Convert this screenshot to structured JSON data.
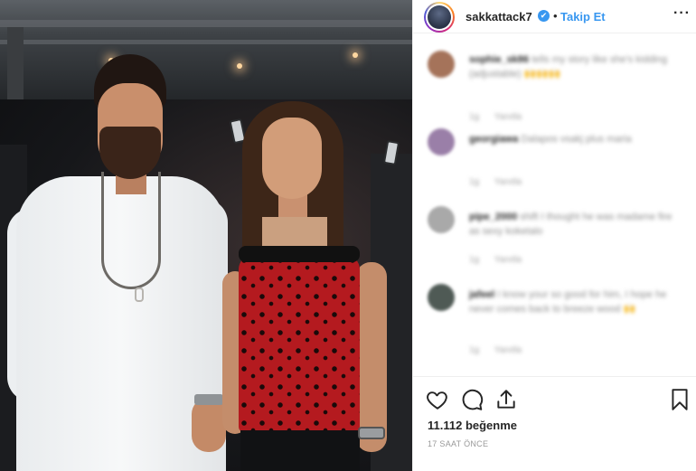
{
  "post": {
    "username": "sakkattack7",
    "verified_mark": "✔",
    "separator": "•",
    "follow_label": "Takip Et",
    "more_icon": "more-options-icon",
    "likes_text": "11.112 beğenme",
    "timestamp": "17 SAAT ÖNCE"
  },
  "comments": [
    {
      "author": "sophie_sk86",
      "text": "tells my story like she's kidding (adjustable) 🙌🙌🙌",
      "meta": "1g Yanıtla",
      "avatar_color": "#a5735a"
    },
    {
      "author": "georgiawa",
      "text": "Dalapos vsakj plus maria",
      "meta": "1g Yanıtla",
      "avatar_color": "#9a7fa8"
    },
    {
      "author": "pipe_2000",
      "text": "shift I thought he was madame fire as sexy koketalo",
      "meta": "1g Yanıtla",
      "avatar_color": "#a9a9a9"
    },
    {
      "author": "jafeel",
      "text": "I know your so good for him, I hope he never comes back to breeze wood 🙌",
      "meta": "1g Yanıtla",
      "avatar_color": "#4f5a55"
    }
  ],
  "icons": {
    "like": "heart-icon",
    "comment": "comment-icon",
    "share": "share-icon",
    "save": "bookmark-icon"
  },
  "colors": {
    "link_blue": "#3897f0",
    "text": "#262626",
    "muted": "#999999",
    "divider": "#efefef"
  }
}
